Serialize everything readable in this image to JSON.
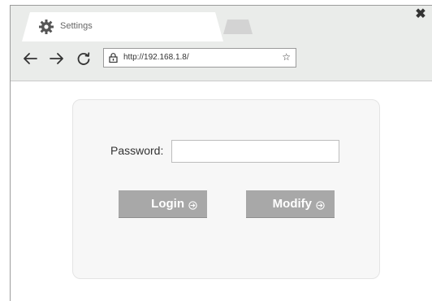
{
  "browser": {
    "tab_title": "Settings",
    "url": "http://192.168.1.8/",
    "icons": {
      "tab": "gear-icon",
      "close": "close-icon",
      "back": "back-arrow-icon",
      "forward": "forward-arrow-icon",
      "reload": "reload-icon",
      "lock": "lock-icon",
      "bookmark": "star-icon"
    },
    "close_glyph": "✖",
    "star_glyph": "☆"
  },
  "login": {
    "password_label": "Password:",
    "password_value": "",
    "login_label": "Login",
    "modify_label": "Modify",
    "button_icon": "arrow-circle-right-icon"
  },
  "colors": {
    "chrome_bg": "#eaecea",
    "button_bg": "#a8a8a8",
    "panel_bg": "#f7f7f7"
  }
}
